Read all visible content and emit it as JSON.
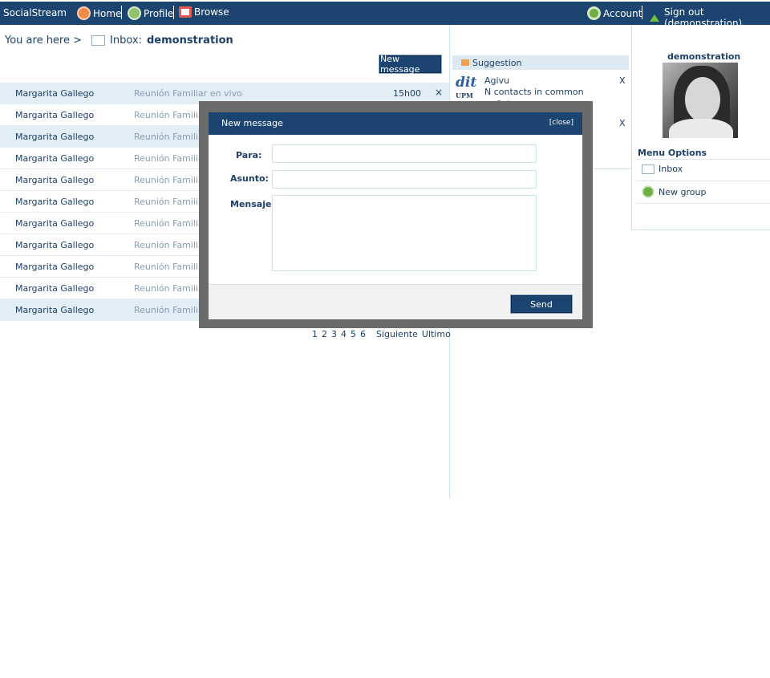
{
  "topbar": {
    "brand": "SocialStream",
    "home": "Home",
    "profile": "Profile",
    "browse": "Browse",
    "account": "Account",
    "signout": "Sign out (demonstration)"
  },
  "breadcrumb": {
    "prefix": "You are here >",
    "inbox": "Inbox:",
    "user": "demonstration"
  },
  "new_message_button": "New message",
  "messages": [
    {
      "from": "Margarita Gallego",
      "subject": "Reunión Familiar en vivo",
      "time": "15h00",
      "delete": "×"
    },
    {
      "from": "Margarita Gallego",
      "subject": "Reunión Familiar"
    },
    {
      "from": "Margarita Gallego",
      "subject": "Reunión Familiar"
    },
    {
      "from": "Margarita Gallego",
      "subject": "Reunión Familiar"
    },
    {
      "from": "Margarita Gallego",
      "subject": "Reunión Familiar"
    },
    {
      "from": "Margarita Gallego",
      "subject": "Reunión Familiar"
    },
    {
      "from": "Margarita Gallego",
      "subject": "Reunión Familiar"
    },
    {
      "from": "Margarita Gallego",
      "subject": "Reunión Familiar"
    },
    {
      "from": "Margarita Gallego",
      "subject": "Reunión Familiar"
    },
    {
      "from": "Margarita Gallego",
      "subject": "Reunión Familiar"
    },
    {
      "from": "Margarita Gallego",
      "subject": "Reunión Familiar"
    }
  ],
  "pagination": {
    "pages": [
      "1",
      "2",
      "3",
      "4",
      "5",
      "6"
    ],
    "next": "Siguiente",
    "last": "Ultimo"
  },
  "suggestion": {
    "header": "Suggestion",
    "logo_text": "dit",
    "logo_sub": "UPM",
    "name": "Agivu",
    "common": "N contacts in common",
    "follow": "+ Follow",
    "dismiss": "X",
    "dismiss2": "X"
  },
  "profile": {
    "name": "demonstration"
  },
  "menu": {
    "title": "Menu Options",
    "items": [
      "Inbox",
      "New group"
    ]
  },
  "modal": {
    "title": "New message",
    "close": "[close]",
    "to_label": "Para:",
    "subject_label": "Asunto:",
    "body_label": "Mensaje:",
    "to_value": "",
    "subject_value": "",
    "body_value": "",
    "send": "Send"
  },
  "colors": {
    "brand": "#1b4470",
    "row_alt": "#e1eef5",
    "overlay": "#6b6b6b"
  }
}
